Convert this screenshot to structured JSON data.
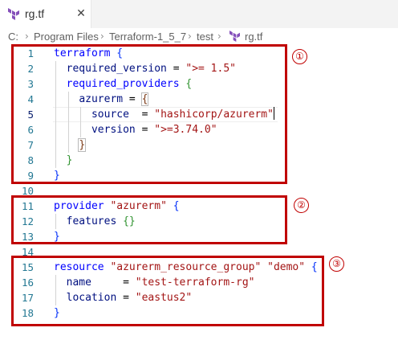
{
  "tab": {
    "label": "rg.tf",
    "close_icon": "close-icon",
    "icon": "terraform-icon"
  },
  "breadcrumb": {
    "items": [
      "C:",
      "Program Files",
      "Terraform-1_5_7",
      "test",
      "rg.tf"
    ],
    "separator": ">"
  },
  "editor": {
    "line_numbers": [
      "1",
      "2",
      "3",
      "4",
      "5",
      "6",
      "7",
      "8",
      "9",
      "10",
      "11",
      "12",
      "13",
      "14",
      "15",
      "16",
      "17",
      "18"
    ],
    "active_line": "5",
    "code": {
      "l1": {
        "kw": "terraform",
        "b": "{"
      },
      "l2": {
        "attr": "required_version",
        "eq": " = ",
        "str": "\">= 1.5\""
      },
      "l3": {
        "attr": "required_providers",
        "b": "{"
      },
      "l4": {
        "attr": "azurerm",
        "eq": " = ",
        "b": "{"
      },
      "l5": {
        "attr": "source",
        "eq": "  = ",
        "str": "\"hashicorp/azurerm\""
      },
      "l6": {
        "attr": "version",
        "eq": " = ",
        "str": "\">=3.74.0\""
      },
      "l7": {
        "b": "}"
      },
      "l8": {
        "b": "}"
      },
      "l9": {
        "b": "}"
      },
      "l11": {
        "kw": "provider",
        "str": "\"azurerm\"",
        "b": "{"
      },
      "l12": {
        "attr": "features",
        "b": "{}"
      },
      "l13": {
        "b": "}"
      },
      "l15": {
        "kw": "resource",
        "str1": "\"azurerm_resource_group\"",
        "str2": "\"demo\"",
        "b": "{"
      },
      "l16": {
        "attr": "name",
        "eq": "     = ",
        "str": "\"test-terraform-rg\""
      },
      "l17": {
        "attr": "location",
        "eq": " = ",
        "str": "\"eastus2\""
      },
      "l18": {
        "b": "}"
      }
    }
  },
  "annotations": {
    "color": "#c00000",
    "labels": [
      "①",
      "②",
      "③"
    ]
  },
  "colors": {
    "keyword": "#0000ff",
    "string": "#a31515",
    "attribute": "#001080",
    "line_number": "#237893"
  }
}
